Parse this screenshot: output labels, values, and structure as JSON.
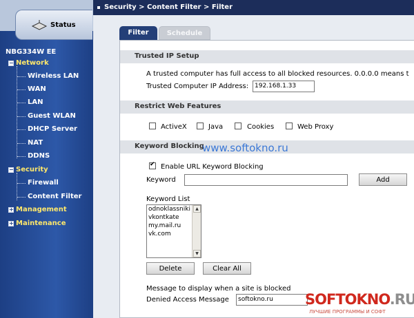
{
  "sidebar": {
    "status_label": "Status",
    "device_name": "NBG334W EE",
    "network": {
      "label": "Network",
      "items": [
        "Wireless LAN",
        "WAN",
        "LAN",
        "Guest WLAN",
        "DHCP Server",
        "NAT",
        "DDNS"
      ]
    },
    "security": {
      "label": "Security",
      "items": [
        "Firewall",
        "Content Filter"
      ]
    },
    "management_label": "Management",
    "maintenance_label": "Maintenance"
  },
  "breadcrumb": "Security > Content Filter > Filter",
  "tabs": [
    "Filter",
    "Schedule"
  ],
  "trusted": {
    "title": "Trusted IP Setup",
    "description": "A trusted computer has full access to all blocked resources. 0.0.0.0 means t",
    "ip_label": "Trusted Computer IP Address:",
    "ip_value": "192.168.1.33"
  },
  "restrict": {
    "title": "Restrict Web Features",
    "options": [
      "ActiveX",
      "Java",
      "Cookies",
      "Web Proxy"
    ]
  },
  "keyword": {
    "title": "Keyword Blocking",
    "enable_label": "Enable URL Keyword Blocking",
    "enable_checked": true,
    "keyword_label": "Keyword",
    "keyword_value": "",
    "add_label": "Add",
    "list_label": "Keyword List",
    "list": [
      "odnoklassniki",
      "vkontkate",
      "my.mail.ru",
      "vk.com"
    ],
    "delete_label": "Delete",
    "clear_label": "Clear All",
    "message_label": "Message to display when a site is blocked",
    "denied_label": "Denied Access Message",
    "denied_value": "softokno.ru"
  },
  "watermark": {
    "url": "www.softokno.ru",
    "logo_main": "SOFTOKNO",
    "logo_suffix": ".RU",
    "logo_sub": "ЛУЧШИЕ ПРОГРАММЫ И СОФТ"
  },
  "colors": {
    "sidebar": "#2d58a8",
    "topbar": "#1c2d5a",
    "tree_head": "#ffe86b",
    "tab_active": "#243f78"
  }
}
